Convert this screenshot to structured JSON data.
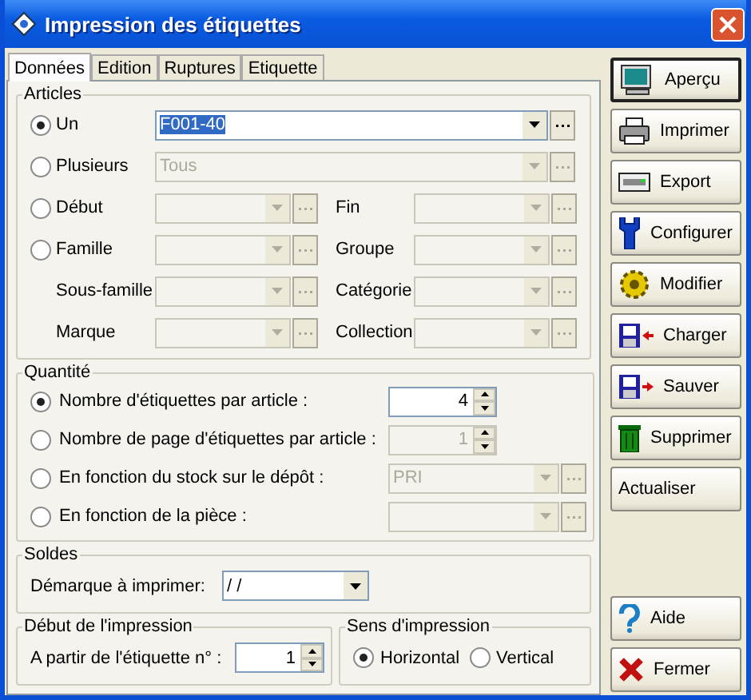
{
  "window": {
    "title": "Impression des étiquettes"
  },
  "tabs": [
    {
      "label": "Données",
      "selected": true
    },
    {
      "label": "Edition",
      "selected": false
    },
    {
      "label": "Ruptures",
      "selected": false
    },
    {
      "label": "Etiquette",
      "selected": false
    }
  ],
  "articles": {
    "title": "Articles",
    "rows": [
      {
        "kind": "radio",
        "label": "Un",
        "selected": true,
        "field": {
          "kind": "wide",
          "value": "F001-40",
          "disabled": false,
          "highlighted": true
        }
      },
      {
        "kind": "radio",
        "label": "Plusieurs",
        "selected": false,
        "field": {
          "kind": "wide",
          "value": "Tous",
          "disabled": true,
          "highlighted": false
        }
      },
      {
        "kind": "radio",
        "label": "Début",
        "selected": false,
        "field": {
          "kind": "pair",
          "right_label": "Fin",
          "disabled": true
        }
      },
      {
        "kind": "radio",
        "label": "Famille",
        "selected": false,
        "field": {
          "kind": "pair",
          "right_label": "Groupe",
          "disabled": true
        }
      },
      {
        "kind": "plain",
        "label": "Sous-famille",
        "field": {
          "kind": "pair",
          "right_label": "Catégorie",
          "disabled": true
        }
      },
      {
        "kind": "plain",
        "label": "Marque",
        "field": {
          "kind": "pair",
          "right_label": "Collection",
          "disabled": true
        }
      }
    ]
  },
  "quantite": {
    "title": "Quantité",
    "rows": [
      {
        "kind": "spin",
        "label": "Nombre d'étiquettes par article :",
        "selected": true,
        "value": "4",
        "disabled": false
      },
      {
        "kind": "spin",
        "label": "Nombre de page d'étiquettes par article :",
        "selected": false,
        "value": "1",
        "disabled": true
      },
      {
        "kind": "combo",
        "label": "En fonction du stock sur le dépôt :",
        "selected": false,
        "value": "PRI",
        "disabled": true
      },
      {
        "kind": "combo",
        "label": "En fonction de la pièce :",
        "selected": false,
        "disabled": true
      }
    ]
  },
  "soldes": {
    "title": "Soldes",
    "label": "Démarque à imprimer:",
    "value": "/ /"
  },
  "debut": {
    "title": "Début de l'impression",
    "label": "A partir de l'étiquette n° :",
    "value": "1"
  },
  "sens": {
    "title": "Sens d'impression",
    "options": [
      {
        "label": "Horizontal",
        "selected": true
      },
      {
        "label": "Vertical",
        "selected": false
      }
    ]
  },
  "buttons": [
    {
      "label": "Aperçu",
      "default": true
    },
    {
      "label": "Imprimer",
      "default": false
    },
    {
      "label": "Export",
      "default": false
    },
    {
      "label": "Configurer",
      "default": false
    },
    {
      "label": "Modifier",
      "default": false
    },
    {
      "label": "Charger",
      "default": false
    },
    {
      "label": "Sauver",
      "default": false
    },
    {
      "label": "Supprimer",
      "default": false
    },
    {
      "label": "Actualiser",
      "default": false
    }
  ],
  "bottom_buttons": [
    {
      "label": "Aide",
      "default": false
    },
    {
      "label": "Fermer",
      "default": false
    }
  ]
}
